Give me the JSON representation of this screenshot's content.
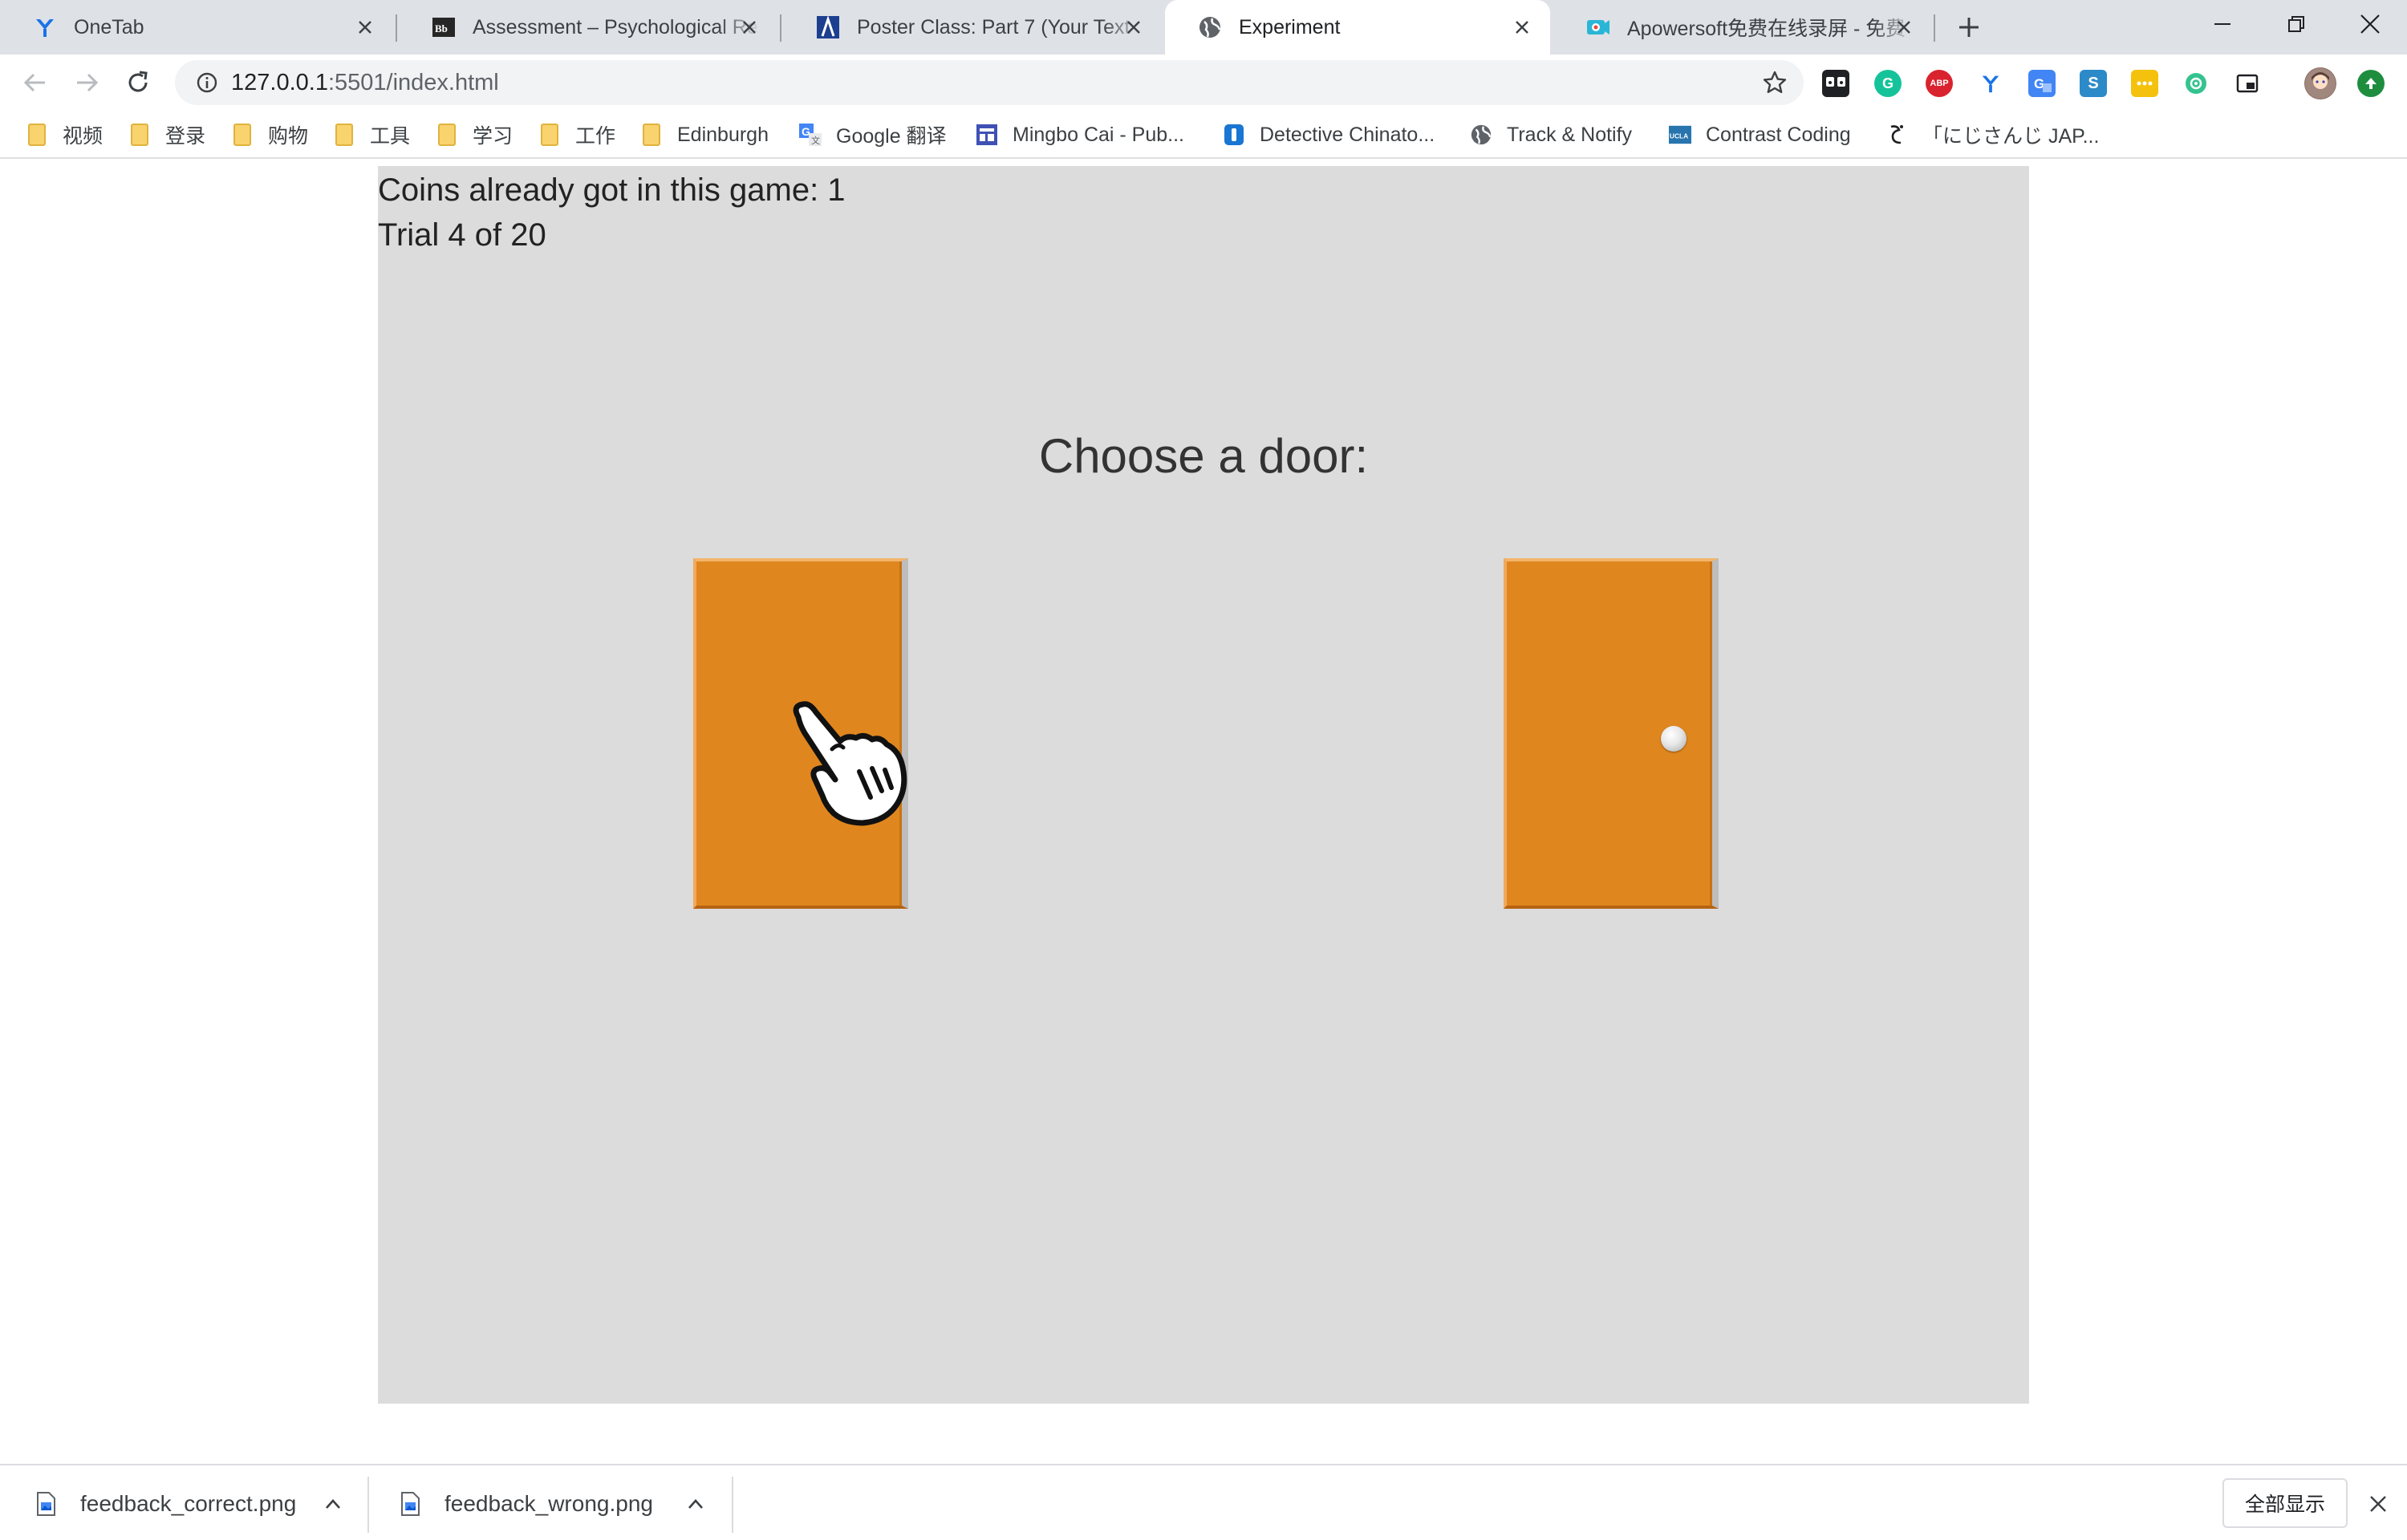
{
  "browser": {
    "tabs": [
      {
        "title": "OneTab",
        "icon": "onetab-icon",
        "active": false
      },
      {
        "title": "Assessment – Psychological Re",
        "icon": "blackboard-icon",
        "active": false
      },
      {
        "title": "Poster Class: Part 7 (Your Text",
        "icon": "poster-icon",
        "active": false
      },
      {
        "title": "Experiment",
        "icon": "globe-icon",
        "active": true
      },
      {
        "title": "Apowersoft免费在线录屏 - 免费",
        "icon": "apowersoft-icon",
        "active": false
      }
    ],
    "url": {
      "host": "127.0.0.1",
      "rest": ":5501/index.html"
    },
    "extensions": [
      {
        "name": "tab-manager-extension-icon",
        "label": "",
        "color": "#202124"
      },
      {
        "name": "grammarly-extension-icon",
        "label": "G",
        "color": "#15c39a"
      },
      {
        "name": "adblock-extension-icon",
        "label": "ABP",
        "color": "#d9232e"
      },
      {
        "name": "onetab-extension-icon",
        "label": "",
        "color": "#ffffff"
      },
      {
        "name": "translate-extension-icon",
        "label": "",
        "color": "#4285f4"
      },
      {
        "name": "s-extension-icon",
        "label": "S",
        "color": "#2c8ac9"
      },
      {
        "name": "yellow-extension-icon",
        "label": "",
        "color": "#f4c20d"
      },
      {
        "name": "green-flower-extension-icon",
        "label": "",
        "color": "#34c38f"
      },
      {
        "name": "pip-extension-icon",
        "label": "",
        "color": "#ffffff"
      },
      {
        "name": "profile-avatar-icon",
        "label": "",
        "color": "#8d6e63"
      },
      {
        "name": "update-arrow-icon",
        "label": "",
        "color": "#1e8e3e"
      }
    ]
  },
  "bookmarks": [
    {
      "label": "视频",
      "icon": "folder-icon"
    },
    {
      "label": "登录",
      "icon": "folder-icon"
    },
    {
      "label": "购物",
      "icon": "folder-icon"
    },
    {
      "label": "工具",
      "icon": "folder-icon"
    },
    {
      "label": "学习",
      "icon": "folder-icon"
    },
    {
      "label": "工作",
      "icon": "folder-icon"
    },
    {
      "label": "Edinburgh",
      "icon": "folder-icon"
    },
    {
      "label": "Google 翻译",
      "icon": "google-translate-icon"
    },
    {
      "label": "Mingbo Cai - Pub...",
      "icon": "site-grid-icon"
    },
    {
      "label": "Detective Chinato...",
      "icon": "video-site-icon"
    },
    {
      "label": "Track & Notify",
      "icon": "globe-icon"
    },
    {
      "label": "Contrast Coding",
      "icon": "ucla-icon"
    },
    {
      "label": "「にじさんじ JAP...",
      "icon": "script-letter-icon"
    }
  ],
  "experiment": {
    "coins_text": "Coins already got in this game: 1",
    "trial_text": "Trial 4 of 20",
    "prompt": "Choose a door:",
    "door_color": "#e0861f",
    "background": "#dcdcdc"
  },
  "downloads": [
    {
      "filename": "feedback_correct.png",
      "icon": "image-file-icon"
    },
    {
      "filename": "feedback_wrong.png",
      "icon": "image-file-icon"
    }
  ],
  "show_all_label": "全部显示"
}
